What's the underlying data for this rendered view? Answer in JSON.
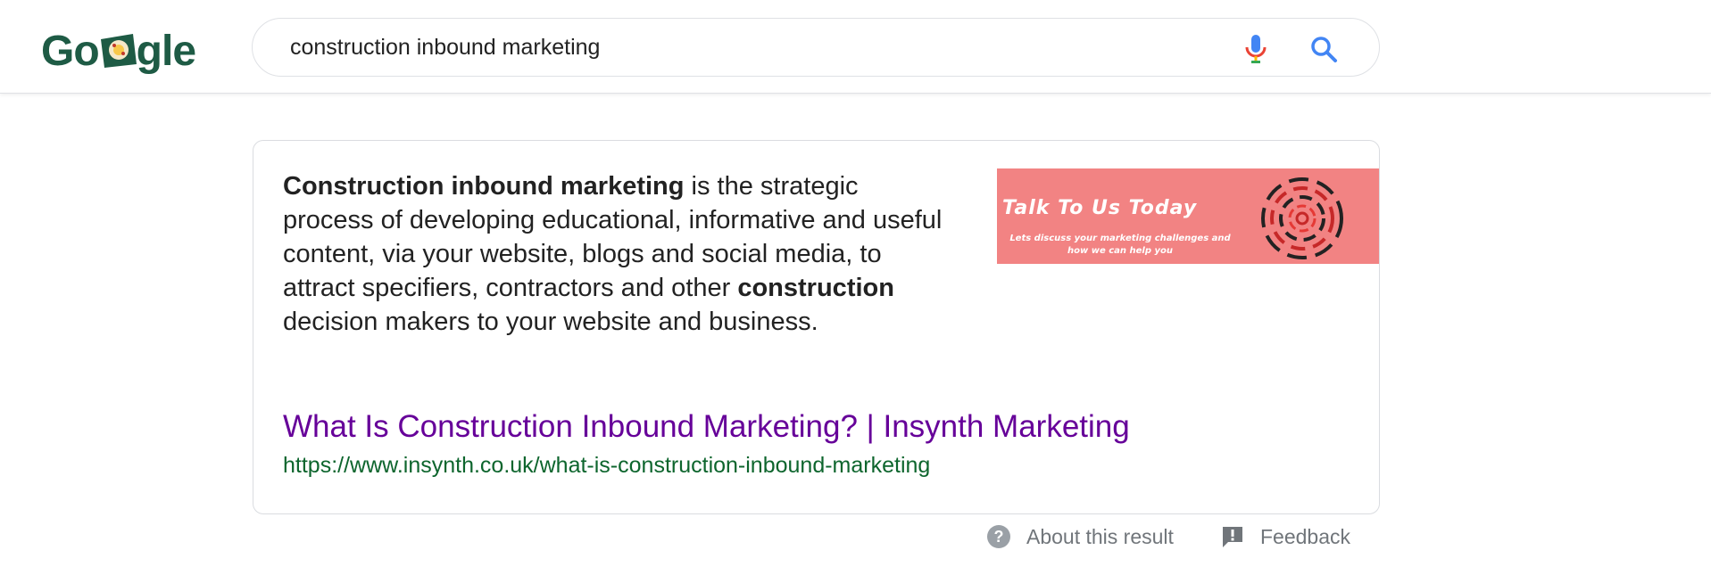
{
  "header": {
    "logo_text_left": "Go",
    "logo_text_right": "gle",
    "search": {
      "value": "construction inbound marketing",
      "placeholder": ""
    }
  },
  "snippet": {
    "bold1": "Construction inbound marketing",
    "text1": " is the strategic process of developing educational, informative and useful content, via your website, blogs and social media, to attract specifiers, contractors and other ",
    "bold2": "construction",
    "text2": " decision makers to your website and business.",
    "image": {
      "title": "Talk To Us Today",
      "subtitle": "Lets discuss your marketing challenges and how we can help you"
    },
    "result_title": "What Is Construction Inbound Marketing? | Insynth Marketing",
    "result_url": "https://www.insynth.co.uk/what-is-construction-inbound-marketing"
  },
  "footer": {
    "about": "About this result",
    "feedback": "Feedback"
  },
  "colors": {
    "logo": "#1e5b45",
    "visited_link": "#660099",
    "url_green": "#0d652d",
    "promo_bg": "#f28383",
    "secondary_text": "#70757a"
  },
  "icons": {
    "mic": "mic-icon",
    "search": "search-icon",
    "about": "question-circle-icon",
    "feedback": "feedback-icon"
  }
}
